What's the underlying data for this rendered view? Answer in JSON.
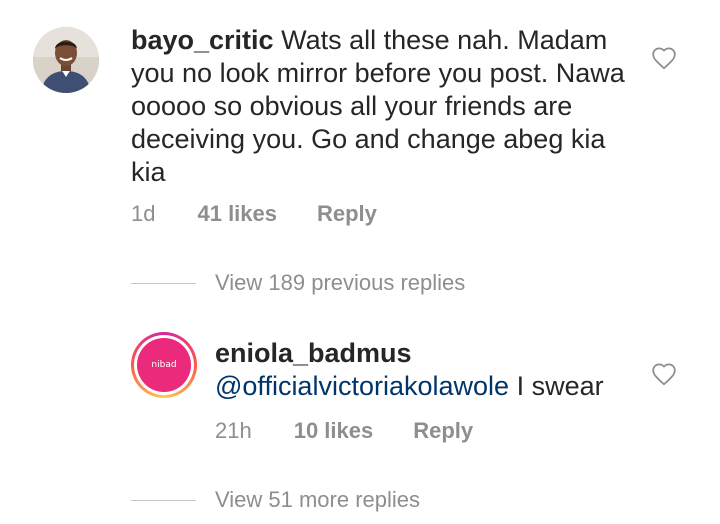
{
  "comments": [
    {
      "username": "bayo_critic",
      "text": "Wats all these nah. Madam you no look mirror before you post. Nawa ooooo so obvious all your friends are deceiving you. Go and change abeg kia kia",
      "time": "1d",
      "likes": "41 likes",
      "reply_label": "Reply",
      "avatar_icon": "user-photo"
    },
    {
      "username": "eniola_badmus",
      "mention": "@officialvictoriakolawole",
      "text": "I swear",
      "time": "21h",
      "likes": "10 likes",
      "reply_label": "Reply",
      "avatar_icon": "brand-logo",
      "avatar_text": "nibad"
    }
  ],
  "view_previous": "View 189 previous replies",
  "view_more": "View 51 more replies",
  "colors": {
    "text": "#262626",
    "muted": "#8e8e8e",
    "mention": "#003569",
    "story_ring_start": "#d6249f",
    "story_ring_end": "#fdcb52",
    "brand": "#ec2a7c"
  }
}
